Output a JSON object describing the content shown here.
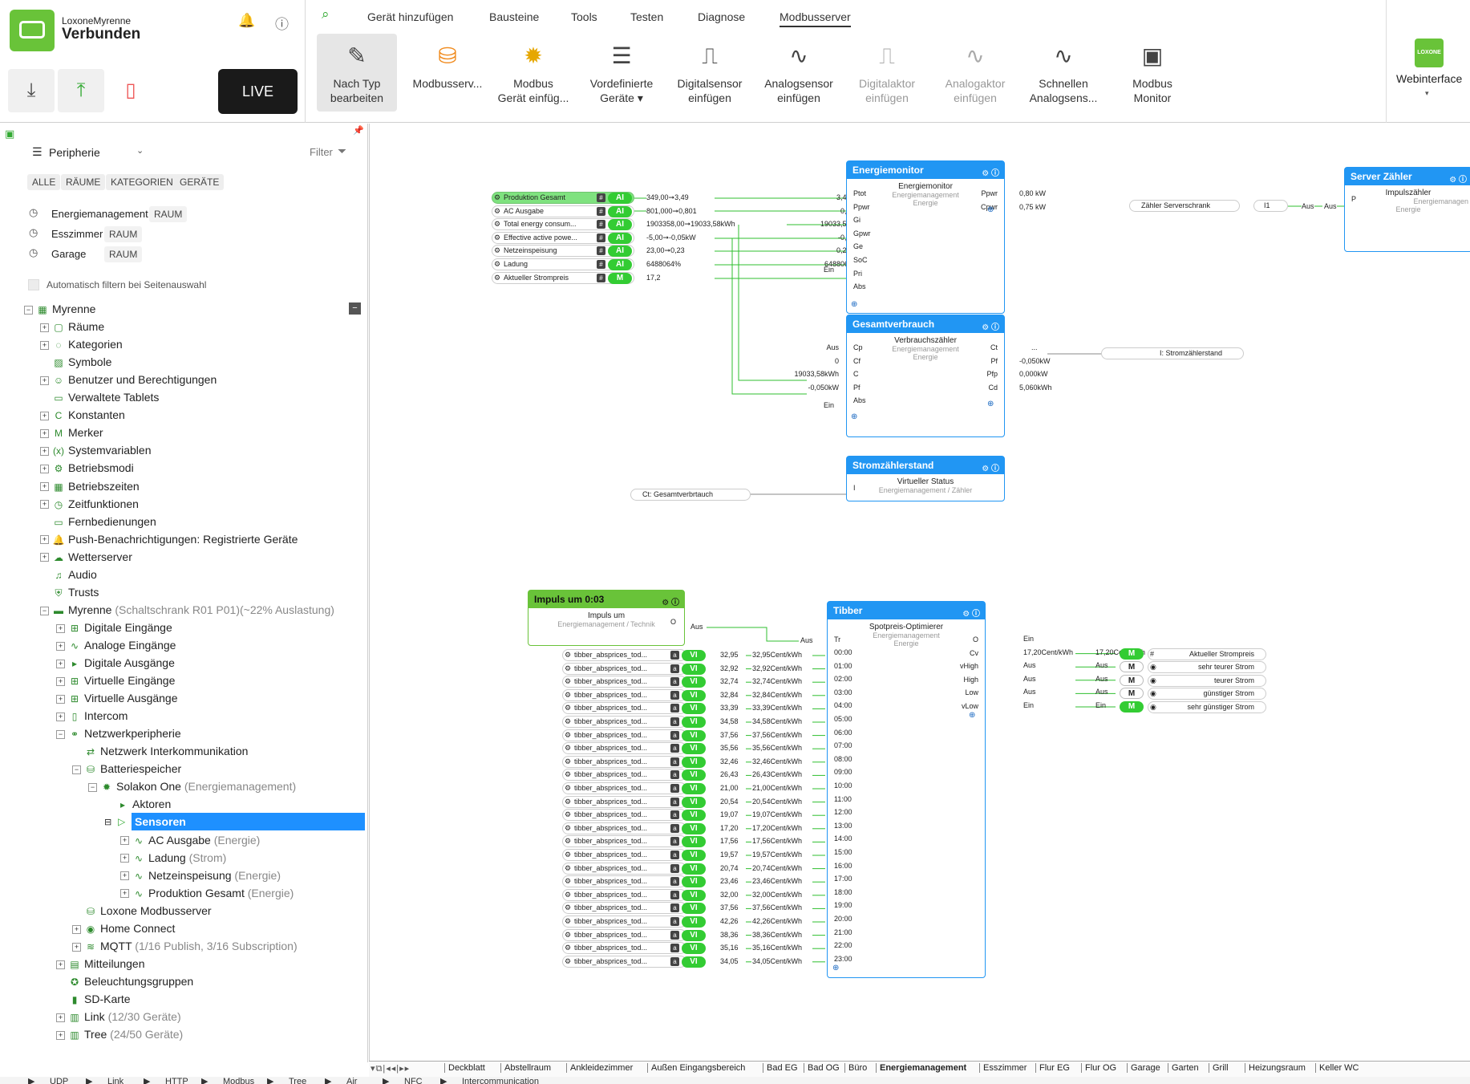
{
  "brand": {
    "line1": "LoxoneMyrenne",
    "line2": "Verbunden",
    "live": "LIVE"
  },
  "menu": [
    "Gerät hinzufügen",
    "Bausteine",
    "Tools",
    "Testen",
    "Diagnose",
    "Modbusserver"
  ],
  "toolbar": [
    {
      "l1": "Nach Typ",
      "l2": "bearbeiten",
      "icon": "edit-type-icon",
      "state": "sel"
    },
    {
      "l1": "Modbusserv...",
      "l2": "",
      "icon": "database-icon",
      "state": ""
    },
    {
      "l1": "Modbus",
      "l2": "Gerät einfüg...",
      "icon": "device-sun-icon",
      "state": ""
    },
    {
      "l1": "Vordefinierte",
      "l2": "Geräte ▾",
      "icon": "stack-icon",
      "state": ""
    },
    {
      "l1": "Digitalsensor",
      "l2": "einfügen",
      "icon": "digital-sensor-icon",
      "state": ""
    },
    {
      "l1": "Analogsensor",
      "l2": "einfügen",
      "icon": "analog-sensor-icon",
      "state": ""
    },
    {
      "l1": "Digitalaktor",
      "l2": "einfügen",
      "icon": "digital-actor-icon",
      "state": "dis"
    },
    {
      "l1": "Analogaktor",
      "l2": "einfügen",
      "icon": "analog-actor-icon",
      "state": "dis"
    },
    {
      "l1": "Schnellen",
      "l2": "Analogsens...",
      "icon": "quick-analog-icon",
      "state": ""
    },
    {
      "l1": "Modbus",
      "l2": "Monitor",
      "icon": "monitor-icon",
      "state": ""
    }
  ],
  "webif": {
    "label": "Webinterface",
    "badge": "LOXONE"
  },
  "left": {
    "panel_title": "Peripherie",
    "filter": "Filter",
    "chips": [
      "ALLE",
      "RÄUME",
      "KATEGORIEN",
      "GERÄTE"
    ],
    "recent": [
      {
        "name": "Energiemanagement",
        "tag": "RAUM"
      },
      {
        "name": "Esszimmer",
        "tag": "RAUM"
      },
      {
        "name": "Garage",
        "tag": "RAUM"
      }
    ],
    "autofilter": "Automatisch filtern bei Seitenauswahl",
    "tree": [
      {
        "d": 0,
        "t": "Myrenne",
        "m": "",
        "x": "−",
        "i": "▦"
      },
      {
        "d": 1,
        "t": "Räume",
        "m": "",
        "x": "+",
        "i": "▢"
      },
      {
        "d": 1,
        "t": "Kategorien",
        "m": "",
        "x": "+",
        "i": "◌"
      },
      {
        "d": 1,
        "t": "Symbole",
        "m": "",
        "x": "",
        "i": "▨"
      },
      {
        "d": 1,
        "t": "Benutzer und Berechtigungen",
        "m": "",
        "x": "+",
        "i": "☺"
      },
      {
        "d": 1,
        "t": "Verwaltete Tablets",
        "m": "",
        "x": "",
        "i": "▭"
      },
      {
        "d": 1,
        "t": "Konstanten",
        "m": "",
        "x": "+",
        "i": "C"
      },
      {
        "d": 1,
        "t": "Merker",
        "m": "",
        "x": "+",
        "i": "M"
      },
      {
        "d": 1,
        "t": "Systemvariablen",
        "m": "",
        "x": "+",
        "i": "(x)"
      },
      {
        "d": 1,
        "t": "Betriebsmodi",
        "m": "",
        "x": "+",
        "i": "⚙"
      },
      {
        "d": 1,
        "t": "Betriebszeiten",
        "m": "",
        "x": "+",
        "i": "▦"
      },
      {
        "d": 1,
        "t": "Zeitfunktionen",
        "m": "",
        "x": "+",
        "i": "◷"
      },
      {
        "d": 1,
        "t": "Fernbedienungen",
        "m": "",
        "x": "",
        "i": "▭"
      },
      {
        "d": 1,
        "t": "Push-Benachrichtigungen: Registrierte Geräte",
        "m": "",
        "x": "+",
        "i": "🔔"
      },
      {
        "d": 1,
        "t": "Wetterserver",
        "m": "",
        "x": "+",
        "i": "☁"
      },
      {
        "d": 1,
        "t": "Audio",
        "m": "",
        "x": "",
        "i": "♫"
      },
      {
        "d": 1,
        "t": "Trusts",
        "m": "",
        "x": "",
        "i": "⛨"
      },
      {
        "d": 1,
        "t": "Myrenne",
        "m": " (Schaltschrank R01 P01)(~22% Auslastung)",
        "x": "−",
        "i": "▬"
      },
      {
        "d": 2,
        "t": "Digitale Eingänge",
        "m": "",
        "x": "+",
        "i": "⊞"
      },
      {
        "d": 2,
        "t": "Analoge Eingänge",
        "m": "",
        "x": "+",
        "i": "∿"
      },
      {
        "d": 2,
        "t": "Digitale Ausgänge",
        "m": "",
        "x": "+",
        "i": "▸"
      },
      {
        "d": 2,
        "t": "Virtuelle Eingänge",
        "m": "",
        "x": "+",
        "i": "⊞"
      },
      {
        "d": 2,
        "t": "Virtuelle Ausgänge",
        "m": "",
        "x": "+",
        "i": "⊞"
      },
      {
        "d": 2,
        "t": "Intercom",
        "m": "",
        "x": "+",
        "i": "▯"
      },
      {
        "d": 2,
        "t": "Netzwerkperipherie",
        "m": "",
        "x": "−",
        "i": "⚭"
      },
      {
        "d": 3,
        "t": "Netzwerk Interkommunikation",
        "m": "",
        "x": "",
        "i": "⇄"
      },
      {
        "d": 3,
        "t": "Batteriespeicher",
        "m": "",
        "x": "−",
        "i": "⛁"
      },
      {
        "d": 4,
        "t": "Solakon One",
        "m": " (Energiemanagement)",
        "x": "−",
        "i": "✹"
      },
      {
        "d": 5,
        "t": "Aktoren",
        "m": "",
        "x": "",
        "i": "▸"
      },
      {
        "d": 5,
        "t": "Sensoren",
        "m": "",
        "x": "−",
        "i": "▷",
        "sel": true
      },
      {
        "d": 6,
        "t": "AC Ausgabe",
        "m": " (Energie)",
        "x": "+",
        "i": "∿"
      },
      {
        "d": 6,
        "t": "Ladung",
        "m": " (Strom)",
        "x": "+",
        "i": "∿"
      },
      {
        "d": 6,
        "t": "Netzeinspeisung",
        "m": " (Energie)",
        "x": "+",
        "i": "∿"
      },
      {
        "d": 6,
        "t": "Produktion Gesamt",
        "m": " (Energie)",
        "x": "+",
        "i": "∿"
      },
      {
        "d": 3,
        "t": "Loxone Modbusserver",
        "m": "",
        "x": "",
        "i": "⛁"
      },
      {
        "d": 3,
        "t": "Home Connect",
        "m": "",
        "x": "+",
        "i": "◉"
      },
      {
        "d": 3,
        "t": "MQTT",
        "m": "   (1/16 Publish, 3/16 Subscription)",
        "x": "+",
        "i": "≋"
      },
      {
        "d": 2,
        "t": "Mitteilungen",
        "m": "",
        "x": "+",
        "i": "▤"
      },
      {
        "d": 2,
        "t": "Beleuchtungsgruppen",
        "m": "",
        "x": "",
        "i": "✪"
      },
      {
        "d": 2,
        "t": "SD-Karte",
        "m": "",
        "x": "",
        "i": "▮"
      },
      {
        "d": 2,
        "t": "Link",
        "m": " (12/30 Geräte)",
        "x": "+",
        "i": "▥"
      },
      {
        "d": 2,
        "t": "Tree",
        "m": "  (24/50 Geräte)",
        "x": "+",
        "i": "▥"
      }
    ]
  },
  "canvas": {
    "sensors": [
      {
        "name": "Produktion Gesamt",
        "type": "AI",
        "raw": "349,00➞3,49",
        "out": "3,49 kWh",
        "hl": true
      },
      {
        "name": "AC Ausgabe",
        "type": "AI",
        "raw": "801,000➞0,801",
        "out": "0,80 kW",
        "hl": false
      },
      {
        "name": "Total energy consum...",
        "type": "AI",
        "raw": "1903358,00➞19033,58kWh",
        "out": "19033,58 kWh",
        "hl": false
      },
      {
        "name": "Effective active powe...",
        "type": "AI",
        "raw": "-5,00➞-0,05kW",
        "out": "-0,05 kW",
        "hl": false
      },
      {
        "name": "Netzeinspeisung",
        "type": "AI",
        "raw": "23,00➞0,23",
        "out": "0,23 kWh",
        "hl": false
      },
      {
        "name": "Ladung",
        "type": "AI",
        "raw": "6488064%",
        "out": "6488064,0 %",
        "hl": false
      },
      {
        "name": "Aktueller Strompreis",
        "type": "M",
        "raw": "17,2",
        "out": "17,2",
        "hl": false
      }
    ],
    "energiemonitor": {
      "title": "Energiemonitor",
      "sub": "Energiemonitor",
      "cat1": "Energiemanagement",
      "cat2": "Energie",
      "inputs": [
        "Ptot",
        "Ppwr",
        "Gi",
        "Gpwr",
        "Ge",
        "SoC",
        "Pri",
        "Abs"
      ],
      "ein": "Ein",
      "outputs": [
        "Ppwr",
        "Cpwr"
      ],
      "outvals": [
        "0,80 kW",
        "0,75 kW"
      ]
    },
    "gesamt": {
      "title": "Gesamtverbrauch",
      "sub": "Verbrauchszähler",
      "cat1": "Energiemanagement",
      "cat2": "Energie",
      "inputs": [
        "Cp",
        "Cf",
        "C",
        "Pf",
        "Abs"
      ],
      "invals": [
        "Aus",
        "0",
        "19033,58kWh",
        "-0,050kW"
      ],
      "ein": "Ein",
      "outputs": [
        "Ct",
        "Pf",
        "Pfp",
        "Cd"
      ],
      "outvals": [
        "...",
        "-0,050kW",
        "0,000kW",
        "5,060kWh"
      ],
      "target": "I: Stromzählerstand"
    },
    "strom": {
      "title": "Stromzählerstand",
      "sub": "Virtueller Status",
      "cat": "Energiemanagement / Zähler",
      "input": "I",
      "src": "Ct: Gesamtverbrtauch"
    },
    "server": {
      "title": "Server Zähler",
      "sub": "Impulszähler",
      "cat1": "Energiemanagen",
      "cat2": "Energie",
      "input": "P",
      "src": "Zähler Serverschrank",
      "srcval": "I1",
      "aus1": "Aus",
      "aus2": "Aus"
    },
    "impuls": {
      "title": "Impuls um 0:03",
      "sub": "Impuls um",
      "cat": "Energiemanagement / Technik",
      "out": "O",
      "aus": "Aus"
    },
    "tibber": {
      "title": "Tibber",
      "sub": "Spotpreis-Optimierer",
      "cat1": "Energiemanagement",
      "cat2": "Energie",
      "tr": "Tr",
      "traus": "Aus",
      "rows": [
        {
          "h": "00:00",
          "raw": "32,95",
          "out": "32,95Cent/kWh"
        },
        {
          "h": "01:00",
          "raw": "32,92",
          "out": "32,92Cent/kWh"
        },
        {
          "h": "02:00",
          "raw": "32,74",
          "out": "32,74Cent/kWh"
        },
        {
          "h": "03:00",
          "raw": "32,84",
          "out": "32,84Cent/kWh"
        },
        {
          "h": "04:00",
          "raw": "33,39",
          "out": "33,39Cent/kWh"
        },
        {
          "h": "05:00",
          "raw": "34,58",
          "out": "34,58Cent/kWh"
        },
        {
          "h": "06:00",
          "raw": "37,56",
          "out": "37,56Cent/kWh"
        },
        {
          "h": "07:00",
          "raw": "35,56",
          "out": "35,56Cent/kWh"
        },
        {
          "h": "08:00",
          "raw": "32,46",
          "out": "32,46Cent/kWh"
        },
        {
          "h": "09:00",
          "raw": "26,43",
          "out": "26,43Cent/kWh"
        },
        {
          "h": "10:00",
          "raw": "21,00",
          "out": "21,00Cent/kWh"
        },
        {
          "h": "11:00",
          "raw": "20,54",
          "out": "20,54Cent/kWh"
        },
        {
          "h": "12:00",
          "raw": "19,07",
          "out": "19,07Cent/kWh"
        },
        {
          "h": "13:00",
          "raw": "17,20",
          "out": "17,20Cent/kWh"
        },
        {
          "h": "14:00",
          "raw": "17,56",
          "out": "17,56Cent/kWh"
        },
        {
          "h": "15:00",
          "raw": "19,57",
          "out": "19,57Cent/kWh"
        },
        {
          "h": "16:00",
          "raw": "20,74",
          "out": "20,74Cent/kWh"
        },
        {
          "h": "17:00",
          "raw": "23,46",
          "out": "23,46Cent/kWh"
        },
        {
          "h": "18:00",
          "raw": "32,00",
          "out": "32,00Cent/kWh"
        },
        {
          "h": "19:00",
          "raw": "37,56",
          "out": "37,56Cent/kWh"
        },
        {
          "h": "20:00",
          "raw": "42,26",
          "out": "42,26Cent/kWh"
        },
        {
          "h": "21:00",
          "raw": "38,36",
          "out": "38,36Cent/kWh"
        },
        {
          "h": "22:00",
          "raw": "35,16",
          "out": "35,16Cent/kWh"
        },
        {
          "h": "23:00",
          "raw": "34,05",
          "out": "34,05Cent/kWh"
        }
      ],
      "rowname": "tibber_absprices_tod...",
      "rowtype": "VI",
      "outs": [
        {
          "p": "O",
          "v": "Ein",
          "tag": "",
          "tgt": ""
        },
        {
          "p": "Cv",
          "v": "17,20Cent/kWh",
          "tag": "M",
          "tgt": "Aktueller Strompreis",
          "on": true
        },
        {
          "p": "vHigh",
          "v": "Aus",
          "tag": "M",
          "tgt": "sehr teurer Strom",
          "on": false
        },
        {
          "p": "High",
          "v": "Aus",
          "tag": "M",
          "tgt": "teurer Strom",
          "on": false
        },
        {
          "p": "Low",
          "v": "Aus",
          "tag": "M",
          "tgt": "günstiger Strom",
          "on": false
        },
        {
          "p": "vLow",
          "v": "Ein",
          "tag": "M",
          "tgt": "sehr günstiger Strom",
          "on": true
        }
      ]
    }
  },
  "tabs": [
    "Deckblatt",
    "Abstellraum",
    "Ankleidezimmer",
    "Außen Eingangsbereich",
    "Bad EG",
    "Bad OG",
    "Büro",
    "Energiemanagement",
    "Esszimmer",
    "Flur EG",
    "Flur OG",
    "Garage",
    "Garten",
    "Grill",
    "Heizungsraum",
    "Keller WC"
  ],
  "active_tab": "Energiemanagement",
  "status": [
    "UDP",
    "Link",
    "HTTP",
    "Modbus",
    "Tree",
    "Air",
    "NFC",
    "Intercommunication"
  ]
}
